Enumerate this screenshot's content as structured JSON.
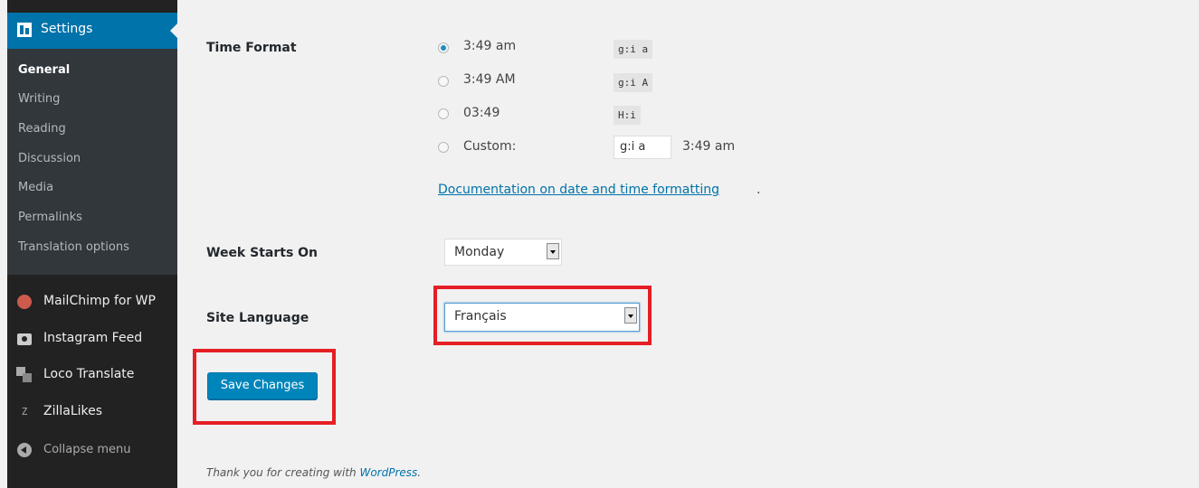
{
  "sidebar": {
    "settings_label": "Settings",
    "submenu": [
      "General",
      "Writing",
      "Reading",
      "Discussion",
      "Media",
      "Permalinks",
      "Translation options"
    ],
    "plugins": [
      {
        "label": "MailChimp for WP",
        "icon": "mailchimp-icon"
      },
      {
        "label": "Instagram Feed",
        "icon": "camera-icon"
      },
      {
        "label": "Loco Translate",
        "icon": "translate-icon"
      },
      {
        "label": "ZillaLikes",
        "icon": "zilla-icon"
      }
    ],
    "collapse_label": "Collapse menu"
  },
  "form": {
    "time_format_label": "Time Format",
    "time_options": [
      {
        "label": "3:49 am",
        "code": "g:i a",
        "checked": true
      },
      {
        "label": "3:49 AM",
        "code": "g:i A",
        "checked": false
      },
      {
        "label": "03:49",
        "code": "H:i",
        "checked": false
      },
      {
        "label": "Custom:",
        "checked": false
      }
    ],
    "custom_value": "g:i a",
    "custom_preview": "3:49 am",
    "doc_link": "Documentation on date and time formatting",
    "doc_period": ".",
    "week_starts_label": "Week Starts On",
    "week_starts_value": "Monday",
    "site_language_label": "Site Language",
    "site_language_value": "Français",
    "save_label": "Save Changes"
  },
  "footer": {
    "text": "Thank you for creating with ",
    "link": "WordPress",
    "period": "."
  },
  "colors": {
    "accent": "#0073aa",
    "highlight": "#e51f25",
    "sidebar_bg": "#222222"
  }
}
